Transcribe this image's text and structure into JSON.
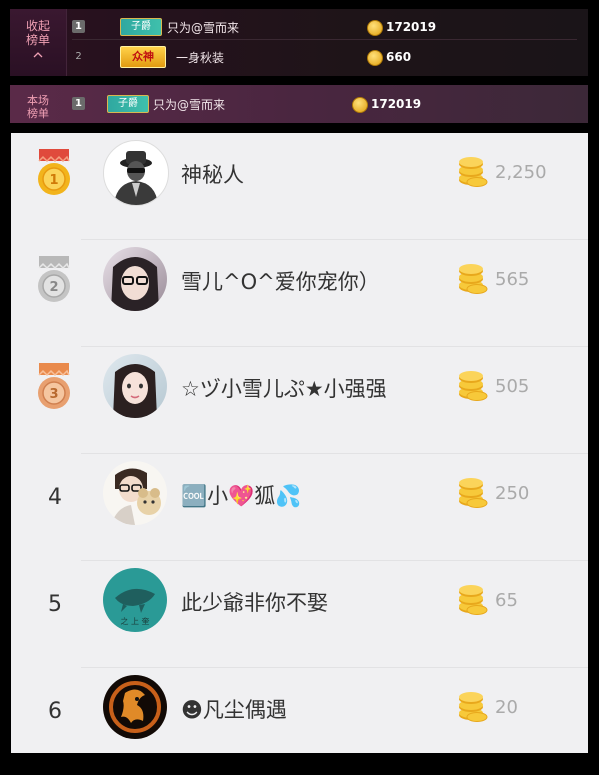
{
  "top_panel": {
    "collapse_label": "收起榜单",
    "rows": [
      {
        "rank": "1",
        "badge": "子爵",
        "name": "只为@雪而来",
        "value": "172019"
      },
      {
        "rank": "2",
        "badge": "众神",
        "name": "一身秋装",
        "value": "660"
      }
    ]
  },
  "session_bar": {
    "label": "本场榜单",
    "rank": "1",
    "badge": "子爵",
    "name": "只为@雪而来",
    "value": "172019"
  },
  "ranking": [
    {
      "rank": "1",
      "name": "神秘人",
      "amount": "2,250",
      "medal": "gold"
    },
    {
      "rank": "2",
      "name": "雪儿^O^爱你宠你）",
      "amount": "565",
      "medal": "silver"
    },
    {
      "rank": "3",
      "name": "☆ヅ小雪儿ぷ★小强强",
      "amount": "505",
      "medal": "bronze"
    },
    {
      "rank": "4",
      "name": "🆒小💖狐💦",
      "amount": "250"
    },
    {
      "rank": "5",
      "name": "此少爺非你不娶",
      "amount": "65"
    },
    {
      "rank": "6",
      "name": "☻凡尘偶遇",
      "amount": "20"
    }
  ],
  "colors": {
    "accent_pink": "#f0a0b4",
    "gold": "#e8a81c"
  }
}
